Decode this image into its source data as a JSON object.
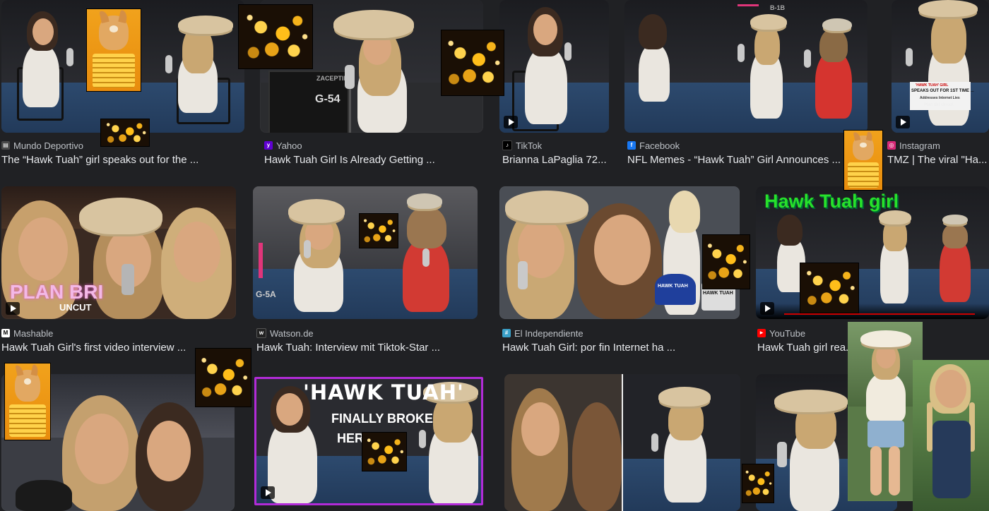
{
  "results": [
    {
      "source": "Mundo Deportivo",
      "title": "The “Hawk Tuah” girl speaks out for the ...",
      "favicon_color": "#4a4a4a",
      "favicon_letter": "▤"
    },
    {
      "source": "Yahoo",
      "title": "Hawk Tuah Girl Is Already Getting ...",
      "favicon_color": "#6001d2",
      "favicon_letter": "y"
    },
    {
      "source": "TikTok",
      "title": "Brianna LaPaglia 72...",
      "favicon_color": "#000000",
      "favicon_letter": "♪"
    },
    {
      "source": "Facebook",
      "title": "NFL Memes - “Hawk Tuah” Girl Announces ...",
      "favicon_color": "#1877f2",
      "favicon_letter": "f"
    },
    {
      "source": "Instagram",
      "title": "TMZ | The viral \"Ha...",
      "favicon_color": "#d62976",
      "favicon_letter": "◎"
    },
    {
      "source": "Mashable",
      "title": "Hawk Tuah Girl's first video interview ...",
      "favicon_color": "#ffffff",
      "favicon_letter": "M"
    },
    {
      "source": "Watson.de",
      "title": "Hawk Tuah: Interview mit Tiktok-Star ...",
      "favicon_color": "#222222",
      "favicon_letter": "w"
    },
    {
      "source": "El Independiente",
      "title": "Hawk Tuah Girl: por fin Internet ha ...",
      "favicon_color": "#3aa0c8",
      "favicon_letter": "#"
    },
    {
      "source": "YouTube",
      "title": "Hawk Tuah girl rea... video ...",
      "favicon_color": "#ff0000",
      "favicon_letter": "▶"
    }
  ],
  "thumb_text": {
    "instagram_overlay_1": "'HAWK TUAH' GIRL",
    "instagram_overlay_2": "SPEAKS OUT FOR 1ST TIME ...",
    "instagram_overlay_3": "Addresses Internet Lies",
    "instagram_overlay_4": "Plan Bri Uncut",
    "case_label": "G-54",
    "case_label_2": "G-5A",
    "case_brand": "ZACEPTINA",
    "plan_bri": "PLAN BRI",
    "uncut": "UNCUT",
    "hawk_tuah_green": "Hawk Tuah girl",
    "hawk_tuah_headline": "'HAWK TUAH'",
    "finally_broke": "FINALLY BROKE",
    "her_s": "HER S",
    "cap_text": "HAWK TUAH",
    "card_text": "HAWK TUAH",
    "room_label": "B-1B"
  }
}
